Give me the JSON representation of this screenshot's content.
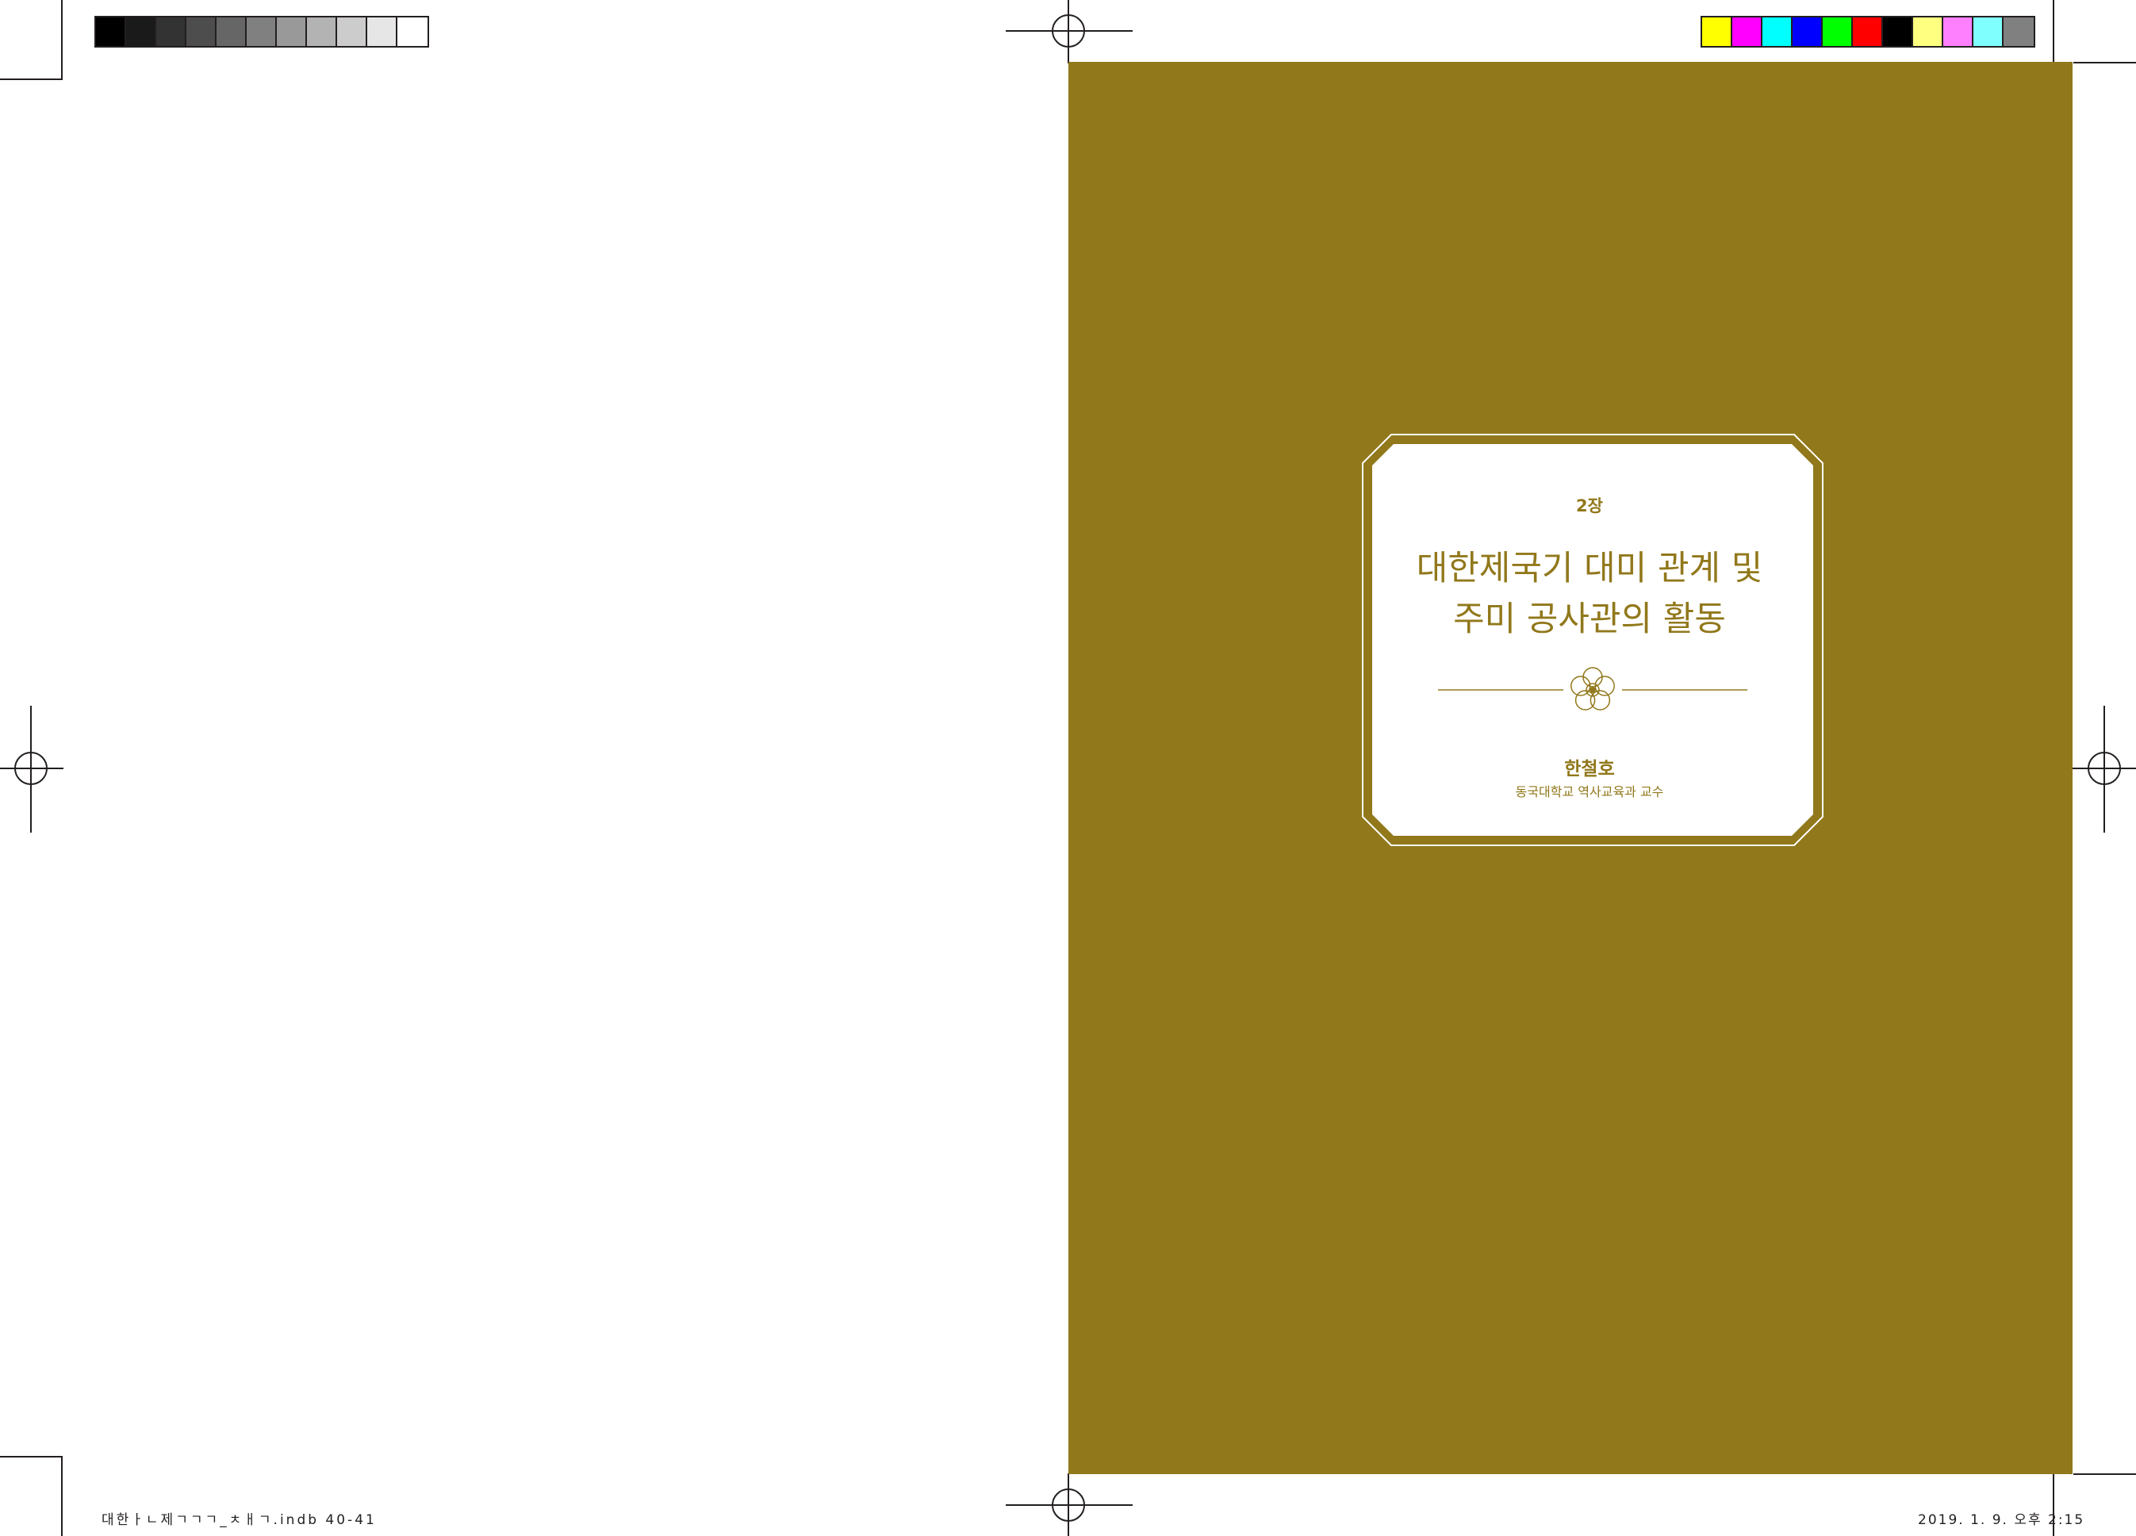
{
  "gray_strip": [
    "#000000",
    "#1a1a1a",
    "#333333",
    "#4d4d4d",
    "#666666",
    "#808080",
    "#999999",
    "#b3b3b3",
    "#cccccc",
    "#e6e6e6",
    "#ffffff"
  ],
  "color_strip": [
    "#ffff00",
    "#ff00ff",
    "#00ffff",
    "#0000ff",
    "#00ff00",
    "#ff0000",
    "#000000",
    "#ffff80",
    "#ff80ff",
    "#80ffff",
    "#808080"
  ],
  "colors": {
    "page": "#91781b",
    "text": "#91781b",
    "marks": "#231f20"
  },
  "cover": {
    "chapter": "2장",
    "title_line1": "대한제국기 대미 관계 및",
    "title_line2": "주미 공사관의 활동",
    "ornament": "plum-blossom-icon",
    "author": "한철호",
    "affiliation": "동국대학교 역사교육과 교수"
  },
  "footer": {
    "filename": "대한ㅏㄴ제ㄱㄱㄱ_ㅊㅐㄱ.indb   40-41",
    "timestamp": "2019. 1. 9.   오후 2:15"
  }
}
